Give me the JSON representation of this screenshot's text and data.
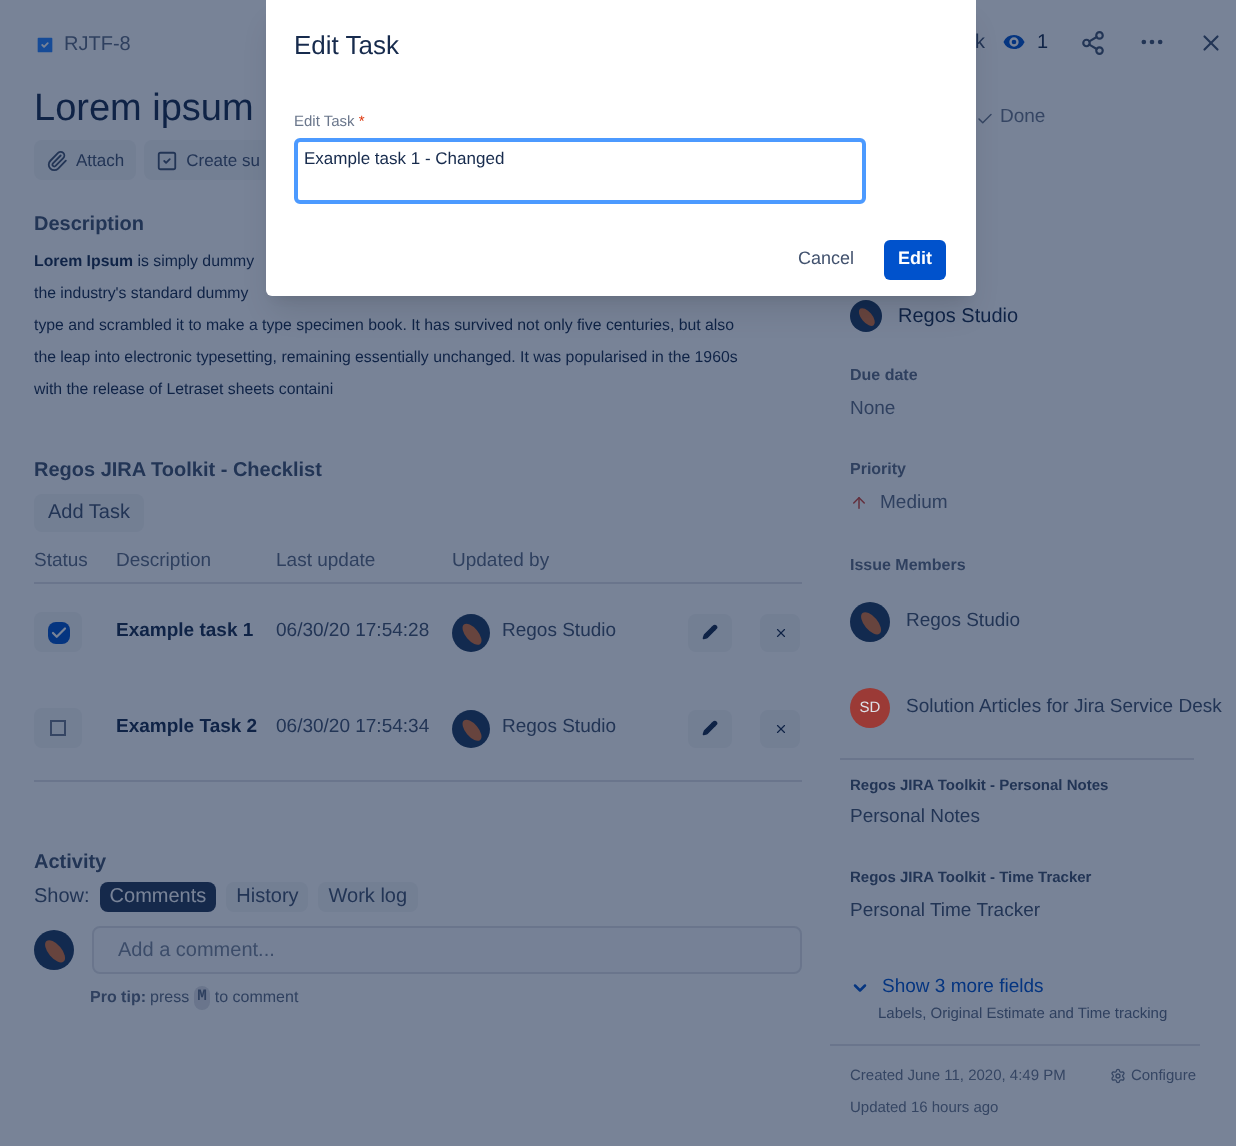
{
  "issue": {
    "key": "RJTF-8",
    "title": "Lorem ipsum",
    "actions": [
      "Attach",
      "Create su"
    ]
  },
  "top_bar": {
    "cut_text": "k",
    "watchers": "1"
  },
  "status": {
    "label": "Done"
  },
  "description": {
    "heading": "Description",
    "lines": [
      "**Lorem Ipsum** is simply dummy",
      "the industry's standard dummy",
      "type and scrambled it to make a type specimen book. It has survived not only five centuries, but also",
      "the leap into electronic typesetting, remaining essentially unchanged. It was popularised in the 1960s",
      "with the release of Letraset sheets containi"
    ]
  },
  "checklist": {
    "heading": "Regos JIRA Toolkit - Checklist",
    "add_button": "Add Task",
    "columns": [
      "Status",
      "Description",
      "Last update",
      "Updated by"
    ],
    "rows": [
      {
        "checked": true,
        "description": "Example task 1",
        "last_update": "06/30/20 17:54:28",
        "updated_by": "Regos Studio"
      },
      {
        "checked": false,
        "description": "Example Task 2",
        "last_update": "06/30/20 17:54:34",
        "updated_by": "Regos Studio"
      }
    ]
  },
  "activity": {
    "heading": "Activity",
    "show_label": "Show:",
    "tabs": [
      {
        "label": "Comments",
        "selected": true
      },
      {
        "label": "History",
        "selected": false
      },
      {
        "label": "Work log",
        "selected": false
      }
    ],
    "comment": {
      "placeholder": "Add a comment..."
    },
    "tip": {
      "bold": "Pro tip:",
      "before": "press",
      "key": "M",
      "after": "to comment"
    }
  },
  "sidebar": {
    "assignee": "Regos Studio",
    "fields": [
      {
        "label": "Due date",
        "value": "None"
      },
      {
        "label": "Priority",
        "value": "Medium"
      }
    ],
    "members_label": "Issue Members",
    "members": [
      {
        "name": "Regos Studio",
        "kind": "avatar"
      },
      {
        "name": "Solution Articles for Jira Service Desk",
        "kind": "initials",
        "initials": "SD",
        "color": "#9b3a36"
      }
    ],
    "notes": [
      {
        "label": "Regos JIRA Toolkit - Personal Notes",
        "value": "Personal Notes"
      },
      {
        "label": "Regos JIRA Toolkit - Time Tracker",
        "value": "Personal Time Tracker"
      }
    ],
    "more": {
      "label": "Show 3 more fields",
      "hint": "Labels, Original Estimate and Time tracking"
    },
    "created": "Created June 11, 2020, 4:49 PM",
    "updated": "Updated 16 hours ago",
    "configure": "Configure"
  },
  "dialog": {
    "title": "Edit Task",
    "field_label": "Edit Task",
    "required_mark": "*",
    "value": "Example task 1 - Changed",
    "buttons": [
      "Cancel",
      "Edit"
    ]
  }
}
